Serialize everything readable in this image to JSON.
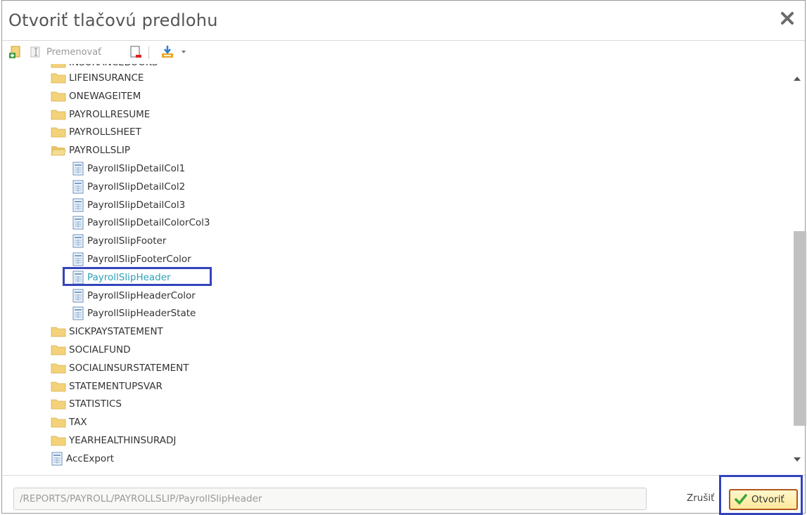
{
  "dialog": {
    "title": "Otvoriť tlačovú predlohu"
  },
  "toolbar": {
    "rename_label": "Premenovať"
  },
  "tree": {
    "partial_top": "INSURANCEBOOKS",
    "items": [
      {
        "label": "LIFEINSURANCE",
        "type": "folder"
      },
      {
        "label": "ONEWAGEITEM",
        "type": "folder"
      },
      {
        "label": "PAYROLLRESUME",
        "type": "folder"
      },
      {
        "label": "PAYROLLSHEET",
        "type": "folder"
      },
      {
        "label": "PAYROLLSLIP",
        "type": "folder-open"
      },
      {
        "label": "PayrollSlipDetailCol1",
        "type": "file"
      },
      {
        "label": "PayrollSlipDetailCol2",
        "type": "file"
      },
      {
        "label": "PayrollSlipDetailCol3",
        "type": "file"
      },
      {
        "label": "PayrollSlipDetailColorCol3",
        "type": "file"
      },
      {
        "label": "PayrollSlipFooter",
        "type": "file"
      },
      {
        "label": "PayrollSlipFooterColor",
        "type": "file"
      },
      {
        "label": "PayrollSlipHeader",
        "type": "file",
        "selected": true
      },
      {
        "label": "PayrollSlipHeaderColor",
        "type": "file"
      },
      {
        "label": "PayrollSlipHeaderState",
        "type": "file"
      },
      {
        "label": "SICKPAYSTATEMENT",
        "type": "folder"
      },
      {
        "label": "SOCIALFUND",
        "type": "folder"
      },
      {
        "label": "SOCIALINSURSTATEMENT",
        "type": "folder"
      },
      {
        "label": "STATEMENTUPSVAR",
        "type": "folder"
      },
      {
        "label": "STATISTICS",
        "type": "folder"
      },
      {
        "label": "TAX",
        "type": "folder"
      },
      {
        "label": "YEARHEALTHINSURADJ",
        "type": "folder"
      },
      {
        "label": "AccExport",
        "type": "file"
      }
    ]
  },
  "footer": {
    "path": "/REPORTS/PAYROLL/PAYROLLSLIP/PayrollSlipHeader",
    "cancel_label": "Zrušiť",
    "ok_label": "Otvoriť"
  },
  "colors": {
    "selection_accent": "#2aa0b8",
    "highlight_frame": "#3344bb",
    "ok_border": "#b2571f"
  }
}
